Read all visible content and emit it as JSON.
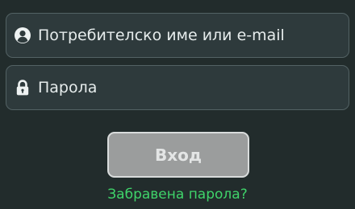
{
  "login_form": {
    "username": {
      "placeholder": "Потребителско име или e-mail",
      "value": "",
      "icon": "user-icon"
    },
    "password": {
      "placeholder": "Парола",
      "value": "",
      "icon": "lock-icon"
    },
    "submit_label": "Вход",
    "forgot_password_label": "Забравена парола?"
  },
  "colors": {
    "background": "#222c2c",
    "field_background": "#2e3a3c",
    "field_border": "#536264",
    "button_background": "#9b9d9d",
    "link": "#3fd46a"
  }
}
